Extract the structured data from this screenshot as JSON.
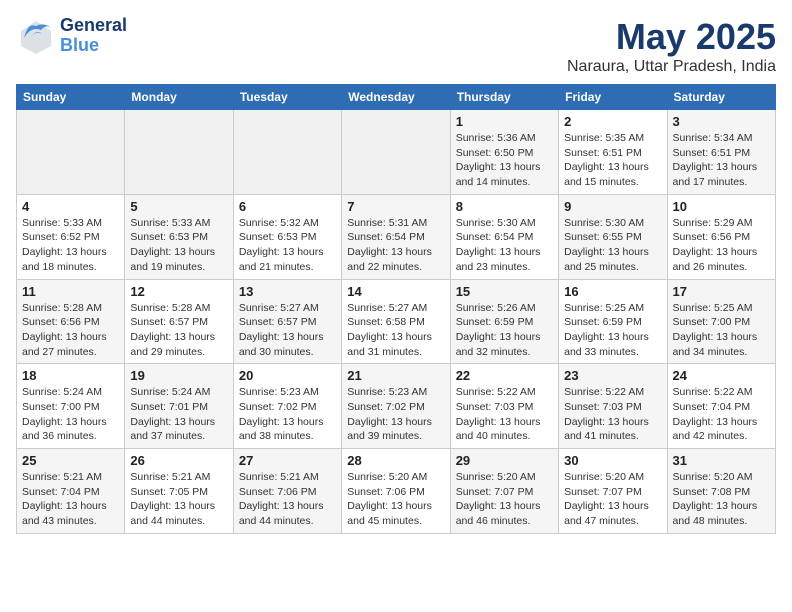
{
  "logo": {
    "general": "General",
    "blue": "Blue"
  },
  "header": {
    "month": "May 2025",
    "location": "Naraura, Uttar Pradesh, India"
  },
  "weekdays": [
    "Sunday",
    "Monday",
    "Tuesday",
    "Wednesday",
    "Thursday",
    "Friday",
    "Saturday"
  ],
  "weeks": [
    [
      {
        "day": "",
        "empty": true
      },
      {
        "day": "",
        "empty": true
      },
      {
        "day": "",
        "empty": true
      },
      {
        "day": "",
        "empty": true
      },
      {
        "day": "1",
        "sunrise": "5:36 AM",
        "sunset": "6:50 PM",
        "daylight": "13 hours and 14 minutes."
      },
      {
        "day": "2",
        "sunrise": "5:35 AM",
        "sunset": "6:51 PM",
        "daylight": "13 hours and 15 minutes."
      },
      {
        "day": "3",
        "sunrise": "5:34 AM",
        "sunset": "6:51 PM",
        "daylight": "13 hours and 17 minutes."
      }
    ],
    [
      {
        "day": "4",
        "sunrise": "5:33 AM",
        "sunset": "6:52 PM",
        "daylight": "13 hours and 18 minutes."
      },
      {
        "day": "5",
        "sunrise": "5:33 AM",
        "sunset": "6:53 PM",
        "daylight": "13 hours and 19 minutes."
      },
      {
        "day": "6",
        "sunrise": "5:32 AM",
        "sunset": "6:53 PM",
        "daylight": "13 hours and 21 minutes."
      },
      {
        "day": "7",
        "sunrise": "5:31 AM",
        "sunset": "6:54 PM",
        "daylight": "13 hours and 22 minutes."
      },
      {
        "day": "8",
        "sunrise": "5:30 AM",
        "sunset": "6:54 PM",
        "daylight": "13 hours and 23 minutes."
      },
      {
        "day": "9",
        "sunrise": "5:30 AM",
        "sunset": "6:55 PM",
        "daylight": "13 hours and 25 minutes."
      },
      {
        "day": "10",
        "sunrise": "5:29 AM",
        "sunset": "6:56 PM",
        "daylight": "13 hours and 26 minutes."
      }
    ],
    [
      {
        "day": "11",
        "sunrise": "5:28 AM",
        "sunset": "6:56 PM",
        "daylight": "13 hours and 27 minutes."
      },
      {
        "day": "12",
        "sunrise": "5:28 AM",
        "sunset": "6:57 PM",
        "daylight": "13 hours and 29 minutes."
      },
      {
        "day": "13",
        "sunrise": "5:27 AM",
        "sunset": "6:57 PM",
        "daylight": "13 hours and 30 minutes."
      },
      {
        "day": "14",
        "sunrise": "5:27 AM",
        "sunset": "6:58 PM",
        "daylight": "13 hours and 31 minutes."
      },
      {
        "day": "15",
        "sunrise": "5:26 AM",
        "sunset": "6:59 PM",
        "daylight": "13 hours and 32 minutes."
      },
      {
        "day": "16",
        "sunrise": "5:25 AM",
        "sunset": "6:59 PM",
        "daylight": "13 hours and 33 minutes."
      },
      {
        "day": "17",
        "sunrise": "5:25 AM",
        "sunset": "7:00 PM",
        "daylight": "13 hours and 34 minutes."
      }
    ],
    [
      {
        "day": "18",
        "sunrise": "5:24 AM",
        "sunset": "7:00 PM",
        "daylight": "13 hours and 36 minutes."
      },
      {
        "day": "19",
        "sunrise": "5:24 AM",
        "sunset": "7:01 PM",
        "daylight": "13 hours and 37 minutes."
      },
      {
        "day": "20",
        "sunrise": "5:23 AM",
        "sunset": "7:02 PM",
        "daylight": "13 hours and 38 minutes."
      },
      {
        "day": "21",
        "sunrise": "5:23 AM",
        "sunset": "7:02 PM",
        "daylight": "13 hours and 39 minutes."
      },
      {
        "day": "22",
        "sunrise": "5:22 AM",
        "sunset": "7:03 PM",
        "daylight": "13 hours and 40 minutes."
      },
      {
        "day": "23",
        "sunrise": "5:22 AM",
        "sunset": "7:03 PM",
        "daylight": "13 hours and 41 minutes."
      },
      {
        "day": "24",
        "sunrise": "5:22 AM",
        "sunset": "7:04 PM",
        "daylight": "13 hours and 42 minutes."
      }
    ],
    [
      {
        "day": "25",
        "sunrise": "5:21 AM",
        "sunset": "7:04 PM",
        "daylight": "13 hours and 43 minutes."
      },
      {
        "day": "26",
        "sunrise": "5:21 AM",
        "sunset": "7:05 PM",
        "daylight": "13 hours and 44 minutes."
      },
      {
        "day": "27",
        "sunrise": "5:21 AM",
        "sunset": "7:06 PM",
        "daylight": "13 hours and 44 minutes."
      },
      {
        "day": "28",
        "sunrise": "5:20 AM",
        "sunset": "7:06 PM",
        "daylight": "13 hours and 45 minutes."
      },
      {
        "day": "29",
        "sunrise": "5:20 AM",
        "sunset": "7:07 PM",
        "daylight": "13 hours and 46 minutes."
      },
      {
        "day": "30",
        "sunrise": "5:20 AM",
        "sunset": "7:07 PM",
        "daylight": "13 hours and 47 minutes."
      },
      {
        "day": "31",
        "sunrise": "5:20 AM",
        "sunset": "7:08 PM",
        "daylight": "13 hours and 48 minutes."
      }
    ]
  ]
}
